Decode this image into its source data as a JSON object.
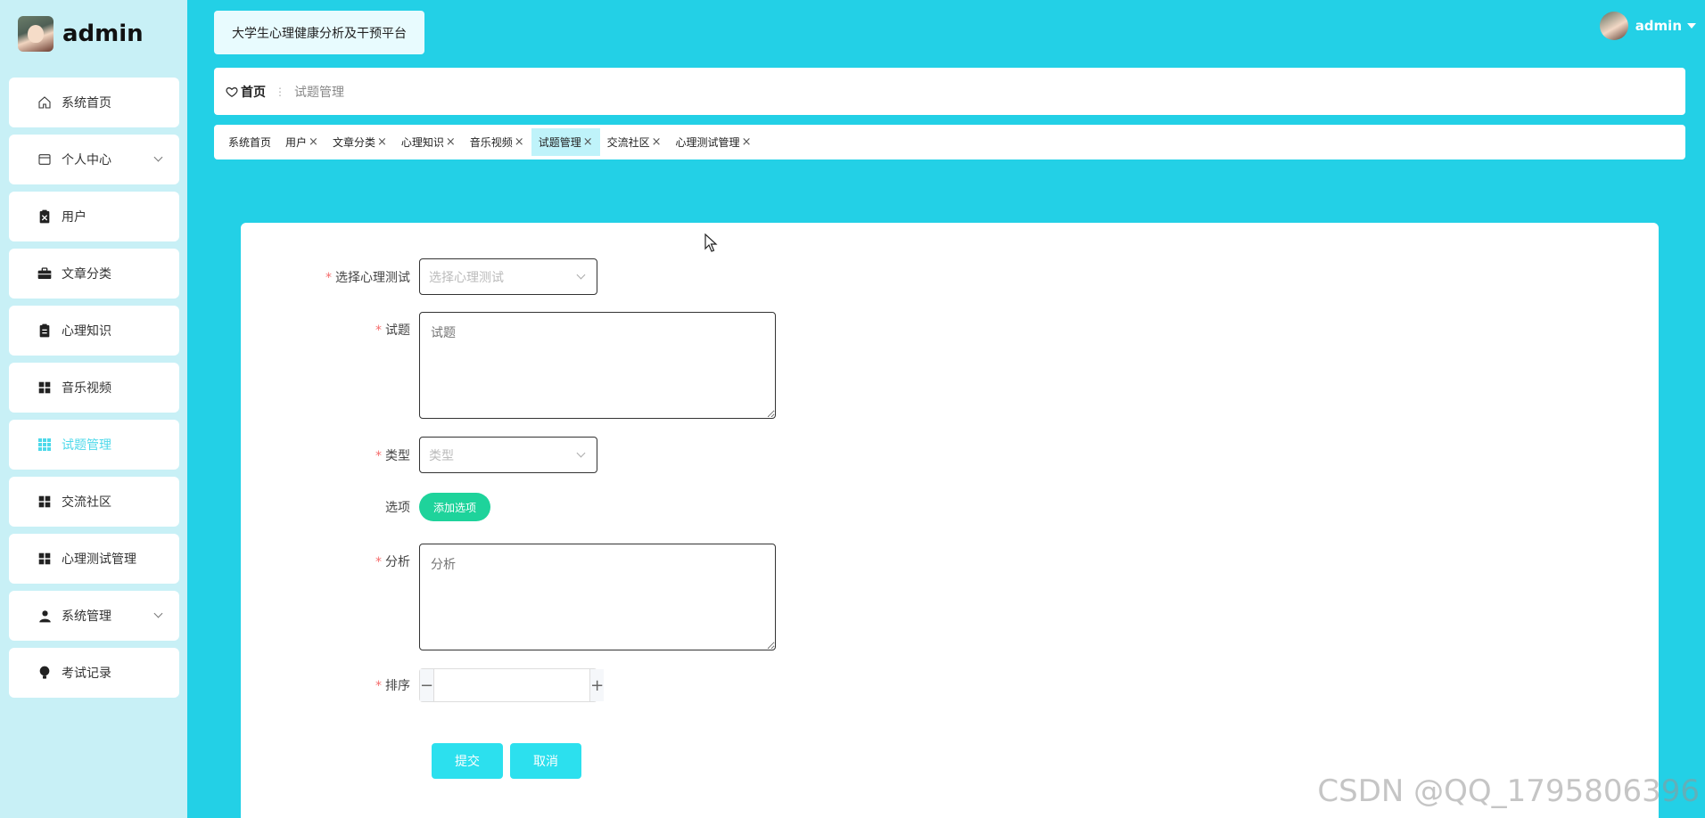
{
  "brand": {
    "title": "admin"
  },
  "sidebar": {
    "items": [
      {
        "label": "系统首页",
        "icon": "home-icon",
        "has_arrow": false,
        "active": false
      },
      {
        "label": "个人中心",
        "icon": "card-icon",
        "has_arrow": true,
        "active": false
      },
      {
        "label": "用户",
        "icon": "clipboard-x-icon",
        "has_arrow": false,
        "active": false
      },
      {
        "label": "文章分类",
        "icon": "briefcase-icon",
        "has_arrow": false,
        "active": false
      },
      {
        "label": "心理知识",
        "icon": "clipboard-icon",
        "has_arrow": false,
        "active": false
      },
      {
        "label": "音乐视频",
        "icon": "grid-icon",
        "has_arrow": false,
        "active": false
      },
      {
        "label": "试题管理",
        "icon": "grid-9-icon",
        "has_arrow": false,
        "active": true
      },
      {
        "label": "交流社区",
        "icon": "grid-icon",
        "has_arrow": false,
        "active": false
      },
      {
        "label": "心理测试管理",
        "icon": "grid-icon",
        "has_arrow": false,
        "active": false
      },
      {
        "label": "系统管理",
        "icon": "user-icon",
        "has_arrow": true,
        "active": false
      },
      {
        "label": "考试记录",
        "icon": "bulb-icon",
        "has_arrow": false,
        "active": false
      }
    ]
  },
  "header": {
    "platform_title": "大学生心理健康分析及干预平台",
    "user_name": "admin"
  },
  "breadcrumb": {
    "home": "首页",
    "separator": "⋮",
    "current": "试题管理"
  },
  "tags": [
    {
      "label": "系统首页",
      "closable": false,
      "active": false
    },
    {
      "label": "用户",
      "closable": true,
      "active": false
    },
    {
      "label": "文章分类",
      "closable": true,
      "active": false
    },
    {
      "label": "心理知识",
      "closable": true,
      "active": false
    },
    {
      "label": "音乐视频",
      "closable": true,
      "active": false
    },
    {
      "label": "试题管理",
      "closable": true,
      "active": true
    },
    {
      "label": "交流社区",
      "closable": true,
      "active": false
    },
    {
      "label": "心理测试管理",
      "closable": true,
      "active": false
    }
  ],
  "form": {
    "test": {
      "label": "选择心理测试",
      "placeholder": "选择心理测试",
      "required": true
    },
    "question": {
      "label": "试题",
      "placeholder": "试题",
      "required": true
    },
    "type": {
      "label": "类型",
      "placeholder": "类型",
      "required": true
    },
    "options": {
      "label": "选项",
      "add_label": "添加选项"
    },
    "analysis": {
      "label": "分析",
      "placeholder": "分析",
      "required": true
    },
    "order": {
      "label": "排序",
      "value": "",
      "required": true,
      "minus": "−",
      "plus": "+"
    },
    "submit_label": "提交",
    "cancel_label": "取消"
  },
  "watermark": "CSDN @QQ_1795806396",
  "colors": {
    "background": "#23d0e6",
    "sidebar": "#c8f0f6",
    "accent": "#4fd9ea",
    "add_button": "#1ed39b",
    "action_button": "#2ce0ee",
    "required": "#f56c6c"
  }
}
